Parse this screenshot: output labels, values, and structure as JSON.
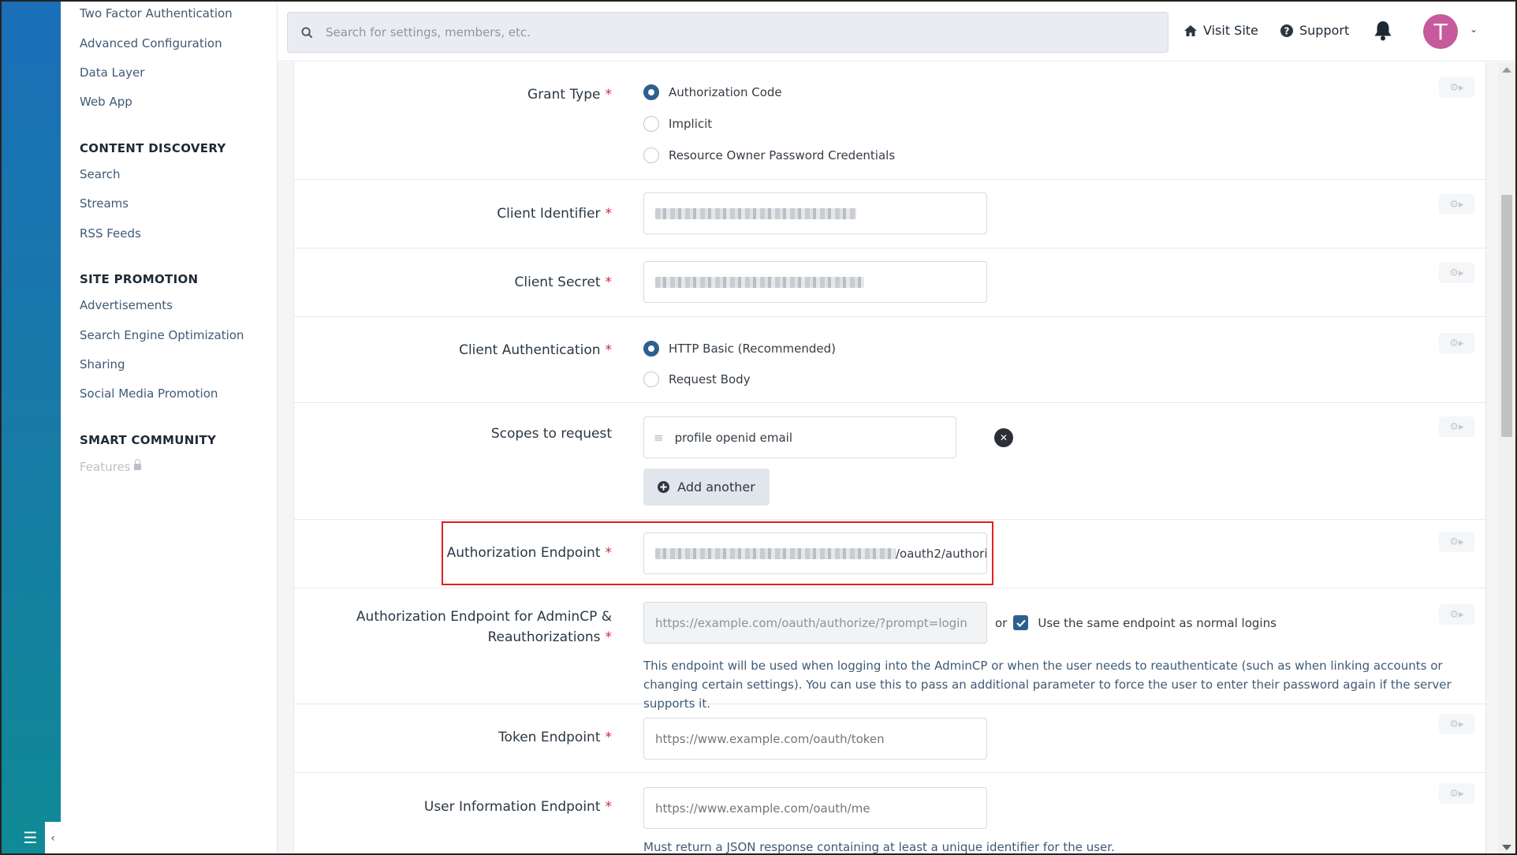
{
  "sidebar": {
    "top_links": [
      "Two Factor Authentication",
      "Advanced Configuration",
      "Data Layer",
      "Web App"
    ],
    "sections": [
      {
        "heading": "CONTENT DISCOVERY",
        "items": [
          "Search",
          "Streams",
          "RSS Feeds"
        ]
      },
      {
        "heading": "SITE PROMOTION",
        "items": [
          "Advertisements",
          "Search Engine Optimization",
          "Sharing",
          "Social Media Promotion"
        ]
      },
      {
        "heading": "SMART COMMUNITY",
        "items": [
          "Features"
        ]
      }
    ]
  },
  "topbar": {
    "search_placeholder": "Search for settings, members, etc.",
    "visit_site": "Visit Site",
    "support": "Support",
    "avatar_initial": "T"
  },
  "form": {
    "grant_type": {
      "label": "Grant Type",
      "options": [
        "Authorization Code",
        "Implicit",
        "Resource Owner Password Credentials"
      ],
      "selected": "Authorization Code"
    },
    "client_identifier": {
      "label": "Client Identifier"
    },
    "client_secret": {
      "label": "Client Secret"
    },
    "client_auth": {
      "label": "Client Authentication",
      "options": [
        "HTTP Basic (Recommended)",
        "Request Body"
      ],
      "selected": "HTTP Basic (Recommended)"
    },
    "scopes": {
      "label": "Scopes to request",
      "value": "profile openid email",
      "add_label": "Add another"
    },
    "auth_endpoint": {
      "label": "Authorization Endpoint",
      "visible_suffix": "/oauth2/authori"
    },
    "auth_endpoint_admin": {
      "label_line1": "Authorization Endpoint for AdminCP &",
      "label_line2": "Reauthorizations",
      "placeholder": "https://example.com/oauth/authorize/?prompt=login",
      "or": "or",
      "checkbox_label": "Use the same endpoint as normal logins",
      "description": "This endpoint will be used when logging into the AdminCP or when the user needs to reauthenticate (such as when linking accounts or changing certain settings). You can use this to pass an additional parameter to force the user to enter their password again if the server supports it."
    },
    "token_endpoint": {
      "label": "Token Endpoint",
      "placeholder": "https://www.example.com/oauth/token"
    },
    "userinfo_endpoint": {
      "label": "User Information Endpoint",
      "placeholder": "https://www.example.com/oauth/me",
      "description": "Must return a JSON response containing at least a unique identifier for the user."
    },
    "required_mark": "*"
  }
}
